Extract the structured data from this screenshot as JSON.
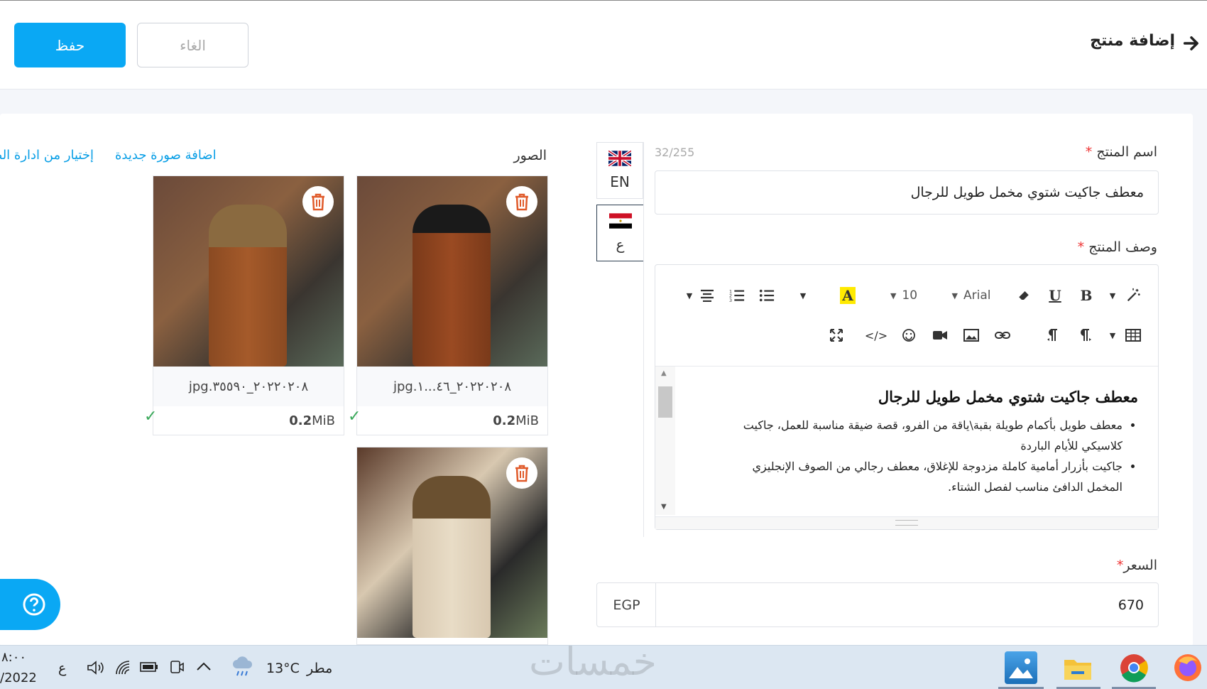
{
  "header": {
    "title": "إضافة منتج",
    "save_label": "حفظ",
    "cancel_label": "الغاء"
  },
  "form": {
    "name_label": "اسم المنتج",
    "required_mark": "*",
    "name_counter": "32/255",
    "name_value": "معطف جاكيت شتوي مخمل طويل للرجال",
    "description_label": "وصف المنتج",
    "price_label": "السعر",
    "price_value": "670",
    "currency": "EGP"
  },
  "languages": [
    {
      "code": "EN"
    },
    {
      "code": "ع"
    }
  ],
  "editor": {
    "font_name": "Arial",
    "font_size": "10",
    "heading": "معطف جاكيت شتوي مخمل طويل للرجال",
    "bullets": [
      "معطف طويل بأكمام طويلة بقبة\\ياقة من الفرو، قصة ضيقة مناسبة للعمل، جاكيت كلاسيكي للأيام الباردة",
      "جاكيت بأزرار أمامية كاملة مزدوجة للإغلاق، معطف رجالي من الصوف الإنجليزي المخمل الدافئ مناسب لفصل الشتاء."
    ]
  },
  "images": {
    "title": "الصور",
    "add_new_label": "اضافة صورة جديدة",
    "choose_label": "إختيار من ادارة الص",
    "items": [
      {
        "name": "٢٠٢٢٠٢٠٨_٤٦...١.jpg",
        "size_value": "0.2",
        "size_unit": "MiB"
      },
      {
        "name": "٢٠٢٢٠٢٠٨_٣٥٥٩٠.jpg",
        "size_value": "0.2",
        "size_unit": "MiB"
      }
    ]
  },
  "taskbar": {
    "time": "٨:٠٠",
    "date": "/2022",
    "lang": "ع",
    "temperature": "13°C",
    "weather": "مطر",
    "watermark": "خمسات"
  },
  "colors": {
    "accent": "#0aa8f4",
    "required": "#e33333",
    "success": "#3aa85a"
  }
}
